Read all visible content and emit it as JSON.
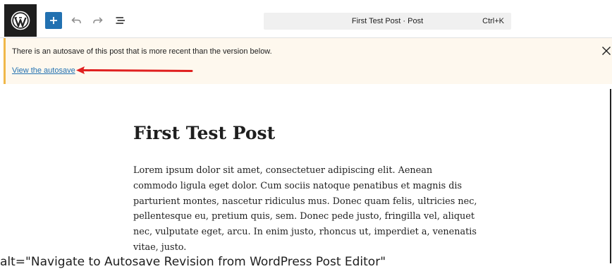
{
  "toolbar": {
    "logo_icon": "wordpress-icon",
    "add_icon": "plus-icon",
    "undo_icon": "undo-icon",
    "redo_icon": "redo-icon",
    "outline_icon": "list-view-icon",
    "command_title": "First Test Post · Post",
    "command_shortcut": "Ctrl+K"
  },
  "notice": {
    "message": "There is an autosave of this post that is more recent than the version below.",
    "link": "View the autosave",
    "close_icon": "close-icon",
    "annotation_arrow_color": "#e02020"
  },
  "post": {
    "title": "First Test Post",
    "body": "Lorem ipsum dolor sit amet, consectetuer adipiscing elit. Aenean commodo ligula eget dolor. Cum sociis natoque penatibus et magnis dis parturient montes, nascetur ridiculus mus. Donec quam felis, ultricies nec, pellentesque eu, pretium quis, sem. Donec pede justo, fringilla vel, aliquet nec, vulputate eget, arcu. In enim justo, rhoncus ut, imperdiet a, venenatis vitae, justo."
  },
  "caption": "alt=\"Navigate to Autosave Revision from WordPress Post Editor\""
}
